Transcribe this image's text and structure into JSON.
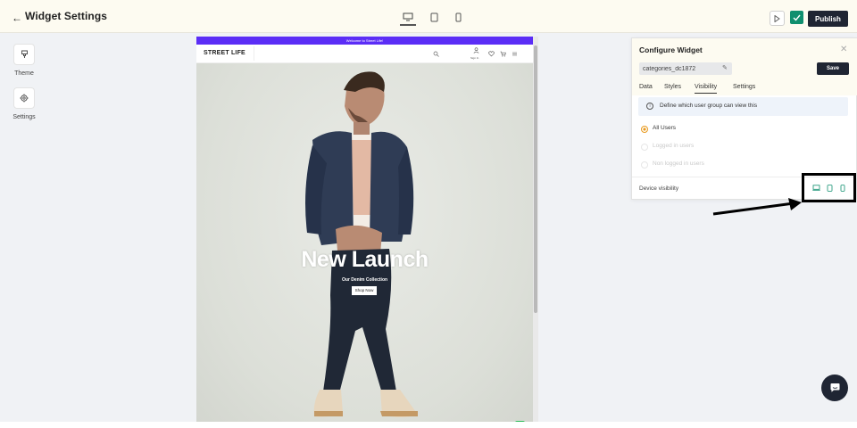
{
  "topbar": {
    "title": "Widget Settings",
    "publish_label": "Publish",
    "device_modes": [
      "desktop-icon",
      "tablet-icon",
      "mobile-icon"
    ],
    "active_device": "desktop"
  },
  "sidebar": {
    "items": [
      {
        "label": "Theme",
        "icon": "brush-icon"
      },
      {
        "label": "Settings",
        "icon": "gear-icon"
      }
    ]
  },
  "preview": {
    "announcement": "Welcome to Street Life!",
    "logo": "STREET LIFE",
    "sign_in": "Sign In",
    "hero_title": "New Launch",
    "hero_subtitle": "Our Denim Collection",
    "shop_button": "Shop Now",
    "announcement_color": "#5b2df6"
  },
  "panel": {
    "title": "Configure Widget",
    "widget_id": "categories_dc1872",
    "save_label": "Save",
    "tabs": [
      "Data",
      "Styles",
      "Visibility",
      "Settings"
    ],
    "active_tab": "Visibility",
    "info_text": "Define which user group can view this",
    "options": [
      {
        "label": "All Users",
        "selected": true
      },
      {
        "label": "Logged in users",
        "selected": false
      },
      {
        "label": "Non logged in users",
        "selected": false
      }
    ],
    "device_visibility_label": "Device visibility",
    "accent_color": "#0f8f6f"
  }
}
